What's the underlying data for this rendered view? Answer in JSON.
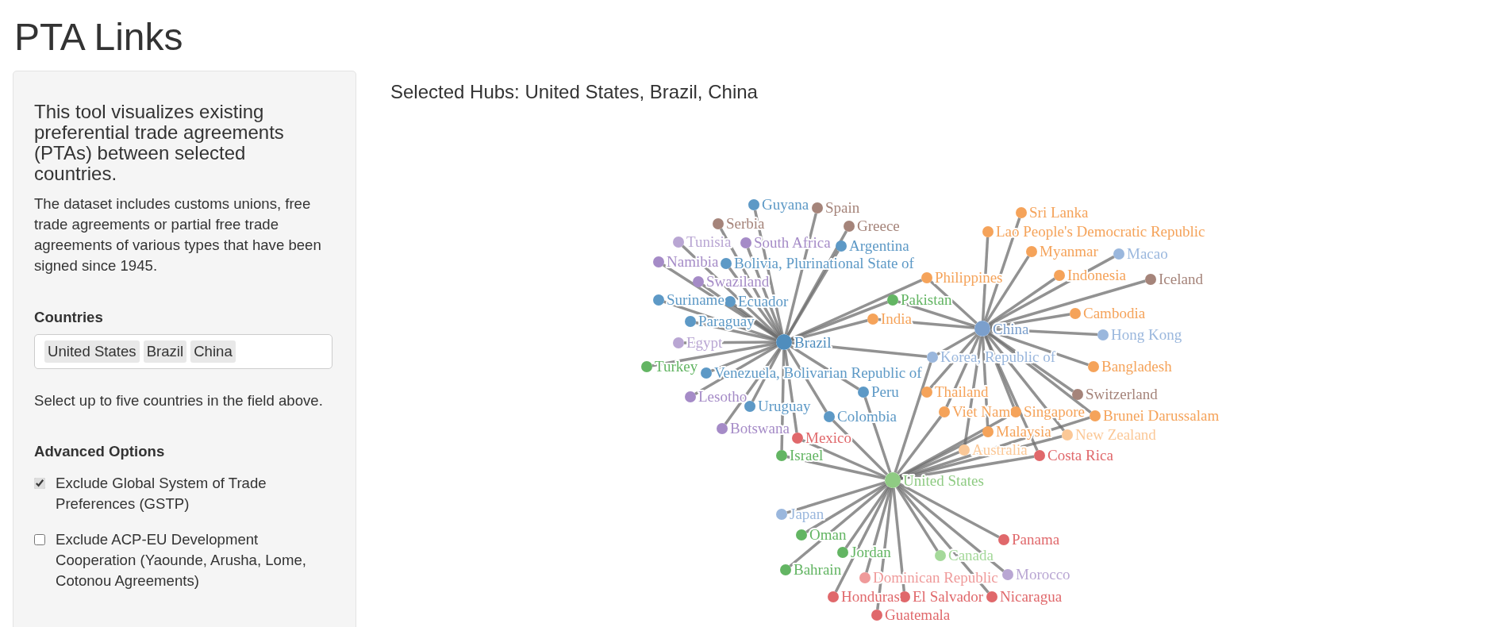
{
  "page": {
    "title": "PTA Links"
  },
  "sidebar": {
    "intro": "This tool visualizes existing preferential trade agreements (PTAs) between selected countries.",
    "description": "The dataset includes customs unions, free trade agreements or partial free trade agreements of various types that have been signed since 1945.",
    "countries": {
      "label": "Countries",
      "tags": [
        "United States",
        "Brazil",
        "China"
      ],
      "help": "Select up to five countries in the field above."
    },
    "advanced_options": {
      "heading": "Advanced Options",
      "options": [
        {
          "label": "Exclude Global System of Trade Preferences (GSTP)",
          "checked": true
        },
        {
          "label": "Exclude ACP-EU Development Cooperation (Yaounde, Arusha, Lome, Cotonou Agreements)",
          "checked": false
        }
      ]
    }
  },
  "main": {
    "heading": "Selected Hubs: United States, Brazil, China",
    "network": {
      "hubs": [
        {
          "label": "United States",
          "color": "#8fcb83"
        },
        {
          "label": "Brazil",
          "color": "#4f8dbd"
        },
        {
          "label": "China",
          "color": "#7b9fcc"
        }
      ],
      "partners": [
        {
          "label": "Guyana",
          "color": "#5d99c6",
          "links": [
            {
              "kind": "brazil"
            }
          ]
        },
        {
          "label": "Spain",
          "color": "#a5847a",
          "links": [
            {
              "kind": "brazil"
            }
          ]
        },
        {
          "label": "Serbia",
          "color": "#a5847a",
          "links": [
            {
              "kind": "brazil"
            }
          ]
        },
        {
          "label": "Greece",
          "color": "#a5847a",
          "links": [
            {
              "kind": "brazil"
            }
          ]
        },
        {
          "label": "Tunisia",
          "color": "#b9a6d3",
          "links": [
            {
              "kind": "brazil"
            }
          ]
        },
        {
          "label": "South Africa",
          "color": "#a58bc7",
          "links": [
            {
              "kind": "brazil"
            }
          ]
        },
        {
          "label": "Argentina",
          "color": "#5d99c6",
          "links": [
            {
              "kind": "brazil"
            }
          ]
        },
        {
          "label": "Namibia",
          "color": "#a58bc7",
          "links": [
            {
              "kind": "brazil"
            }
          ]
        },
        {
          "label": "Bolivia, Plurinational State of",
          "color": "#5d99c6",
          "links": [
            {
              "kind": "brazil"
            }
          ]
        },
        {
          "label": "Swaziland",
          "color": "#a58bc7",
          "links": [
            {
              "kind": "brazil"
            }
          ]
        },
        {
          "label": "Suriname",
          "color": "#5d99c6",
          "links": [
            {
              "kind": "brazil"
            }
          ]
        },
        {
          "label": "Ecuador",
          "color": "#5d99c6",
          "links": [
            {
              "kind": "brazil"
            }
          ]
        },
        {
          "label": "Paraguay",
          "color": "#5d99c6",
          "links": [
            {
              "kind": "brazil"
            }
          ]
        },
        {
          "label": "Egypt",
          "color": "#b9a6d3",
          "links": [
            {
              "kind": "brazil"
            }
          ]
        },
        {
          "label": "Turkey",
          "color": "#63b563",
          "links": [
            {
              "kind": "brazil"
            }
          ]
        },
        {
          "label": "Venezuela, Bolivarian Republic of",
          "color": "#5d99c6",
          "links": [
            {
              "kind": "brazil"
            }
          ]
        },
        {
          "label": "Lesotho",
          "color": "#a58bc7",
          "links": [
            {
              "kind": "brazil"
            }
          ]
        },
        {
          "label": "Uruguay",
          "color": "#5d99c6",
          "links": [
            {
              "kind": "brazil"
            }
          ]
        },
        {
          "label": "Botswana",
          "color": "#a58bc7",
          "links": [
            {
              "kind": "brazil"
            }
          ]
        },
        {
          "label": "Mexico",
          "color": "#e0686b",
          "links": [
            {
              "kind": "usa"
            },
            {
              "kind": "brazil"
            }
          ]
        },
        {
          "label": "Colombia",
          "color": "#5d99c6",
          "links": [
            {
              "kind": "usa"
            },
            {
              "kind": "brazil"
            }
          ]
        },
        {
          "label": "Israel",
          "color": "#63b563",
          "links": [
            {
              "kind": "usa"
            },
            {
              "kind": "brazil"
            }
          ]
        },
        {
          "label": "Peru",
          "color": "#5d99c6",
          "links": [
            {
              "kind": "usa"
            },
            {
              "kind": "brazil"
            }
          ]
        },
        {
          "label": "Philippines",
          "color": "#f5a35a",
          "links": [
            {
              "kind": "brazil"
            },
            {
              "kind": "china"
            }
          ]
        },
        {
          "label": "Pakistan",
          "color": "#63b563",
          "links": [
            {
              "kind": "brazil"
            },
            {
              "kind": "china"
            }
          ]
        },
        {
          "label": "India",
          "color": "#f5a35a",
          "links": [
            {
              "kind": "brazil"
            },
            {
              "kind": "china"
            }
          ]
        },
        {
          "label": "Korea, Republic of",
          "color": "#9ab7dd",
          "links": [
            {
              "kind": "usa"
            },
            {
              "kind": "brazil"
            },
            {
              "kind": "china"
            }
          ]
        },
        {
          "label": "Sri Lanka",
          "color": "#f5a35a",
          "links": [
            {
              "kind": "china"
            }
          ]
        },
        {
          "label": "Lao People's Democratic Republic",
          "color": "#f5a35a",
          "links": [
            {
              "kind": "china"
            }
          ]
        },
        {
          "label": "Myanmar",
          "color": "#f5a35a",
          "links": [
            {
              "kind": "china"
            }
          ]
        },
        {
          "label": "Macao",
          "color": "#9ab7dd",
          "links": [
            {
              "kind": "china"
            }
          ]
        },
        {
          "label": "Indonesia",
          "color": "#f5a35a",
          "links": [
            {
              "kind": "china"
            }
          ]
        },
        {
          "label": "Iceland",
          "color": "#a5847a",
          "links": [
            {
              "kind": "china"
            }
          ]
        },
        {
          "label": "Cambodia",
          "color": "#f5a35a",
          "links": [
            {
              "kind": "china"
            }
          ]
        },
        {
          "label": "Hong Kong",
          "color": "#9ab7dd",
          "links": [
            {
              "kind": "china"
            }
          ]
        },
        {
          "label": "Bangladesh",
          "color": "#f5a35a",
          "links": [
            {
              "kind": "china"
            }
          ]
        },
        {
          "label": "Thailand",
          "color": "#f5a35a",
          "links": [
            {
              "kind": "china"
            }
          ]
        },
        {
          "label": "Switzerland",
          "color": "#a5847a",
          "links": [
            {
              "kind": "china"
            }
          ]
        },
        {
          "label": "Viet Nam",
          "color": "#f5a35a",
          "links": [
            {
              "kind": "usa"
            },
            {
              "kind": "china"
            }
          ]
        },
        {
          "label": "Singapore",
          "color": "#f5a35a",
          "links": [
            {
              "kind": "usa"
            },
            {
              "kind": "china"
            }
          ]
        },
        {
          "label": "Brunei Darussalam",
          "color": "#f5a35a",
          "links": [
            {
              "kind": "usa"
            },
            {
              "kind": "china"
            }
          ]
        },
        {
          "label": "Malaysia",
          "color": "#f5a35a",
          "links": [
            {
              "kind": "usa"
            },
            {
              "kind": "china"
            }
          ]
        },
        {
          "label": "New Zealand",
          "color": "#fbc897",
          "links": [
            {
              "kind": "usa"
            },
            {
              "kind": "china"
            }
          ]
        },
        {
          "label": "Australia",
          "color": "#fbc897",
          "links": [
            {
              "kind": "usa"
            },
            {
              "kind": "china"
            }
          ]
        },
        {
          "label": "Costa Rica",
          "color": "#e0686b",
          "links": [
            {
              "kind": "usa"
            },
            {
              "kind": "china"
            }
          ]
        },
        {
          "label": "Japan",
          "color": "#9ab7dd",
          "links": [
            {
              "kind": "usa"
            }
          ]
        },
        {
          "label": "Oman",
          "color": "#63b563",
          "links": [
            {
              "kind": "usa"
            }
          ]
        },
        {
          "label": "Jordan",
          "color": "#63b563",
          "links": [
            {
              "kind": "usa"
            }
          ]
        },
        {
          "label": "Canada",
          "color": "#a5d99a",
          "links": [
            {
              "kind": "usa"
            }
          ]
        },
        {
          "label": "Panama",
          "color": "#e0686b",
          "links": [
            {
              "kind": "usa"
            }
          ]
        },
        {
          "label": "Bahrain",
          "color": "#63b563",
          "links": [
            {
              "kind": "usa"
            }
          ]
        },
        {
          "label": "Dominican Republic",
          "color": "#ef9a9a",
          "links": [
            {
              "kind": "usa"
            }
          ]
        },
        {
          "label": "Morocco",
          "color": "#b9a6d3",
          "links": [
            {
              "kind": "usa"
            }
          ]
        },
        {
          "label": "Honduras",
          "color": "#e0686b",
          "links": [
            {
              "kind": "usa"
            }
          ]
        },
        {
          "label": "El Salvador",
          "color": "#e0686b",
          "links": [
            {
              "kind": "usa"
            }
          ]
        },
        {
          "label": "Nicaragua",
          "color": "#e0686b",
          "links": [
            {
              "kind": "usa"
            }
          ]
        },
        {
          "label": "Guatemala",
          "color": "#e0686b",
          "links": [
            {
              "kind": "usa"
            }
          ]
        }
      ]
    }
  }
}
